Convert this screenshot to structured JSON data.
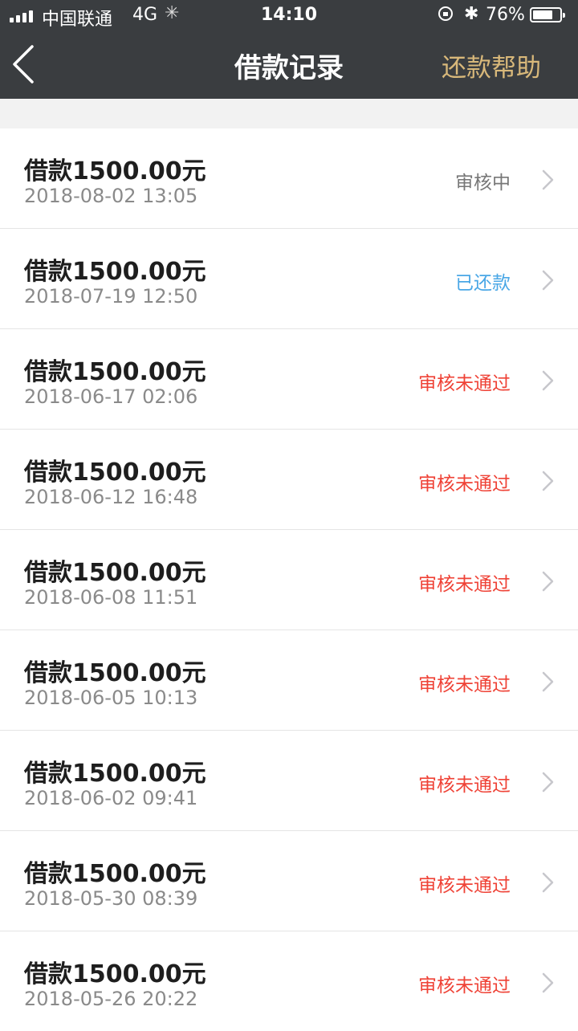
{
  "status_bar": {
    "carrier": "中国联通",
    "network": "4G",
    "time": "14:10",
    "battery": "76%",
    "battery_level": 0.76
  },
  "nav": {
    "title": "借款记录",
    "help_label": "还款帮助"
  },
  "colors": {
    "pending": "#777777",
    "repaid": "#4aa7e6",
    "rejected": "#ef4236",
    "accent": "#d8b87a"
  },
  "records": [
    {
      "amount": "借款1500.00元",
      "date": "2018-08-02 13:05",
      "status": "审核中",
      "status_type": "pending"
    },
    {
      "amount": "借款1500.00元",
      "date": "2018-07-19 12:50",
      "status": "已还款",
      "status_type": "repaid"
    },
    {
      "amount": "借款1500.00元",
      "date": "2018-06-17 02:06",
      "status": "审核未通过",
      "status_type": "rejected"
    },
    {
      "amount": "借款1500.00元",
      "date": "2018-06-12 16:48",
      "status": "审核未通过",
      "status_type": "rejected"
    },
    {
      "amount": "借款1500.00元",
      "date": "2018-06-08 11:51",
      "status": "审核未通过",
      "status_type": "rejected"
    },
    {
      "amount": "借款1500.00元",
      "date": "2018-06-05 10:13",
      "status": "审核未通过",
      "status_type": "rejected"
    },
    {
      "amount": "借款1500.00元",
      "date": "2018-06-02 09:41",
      "status": "审核未通过",
      "status_type": "rejected"
    },
    {
      "amount": "借款1500.00元",
      "date": "2018-05-30 08:39",
      "status": "审核未通过",
      "status_type": "rejected"
    },
    {
      "amount": "借款1500.00元",
      "date": "2018-05-26 20:22",
      "status": "审核未通过",
      "status_type": "rejected"
    }
  ]
}
